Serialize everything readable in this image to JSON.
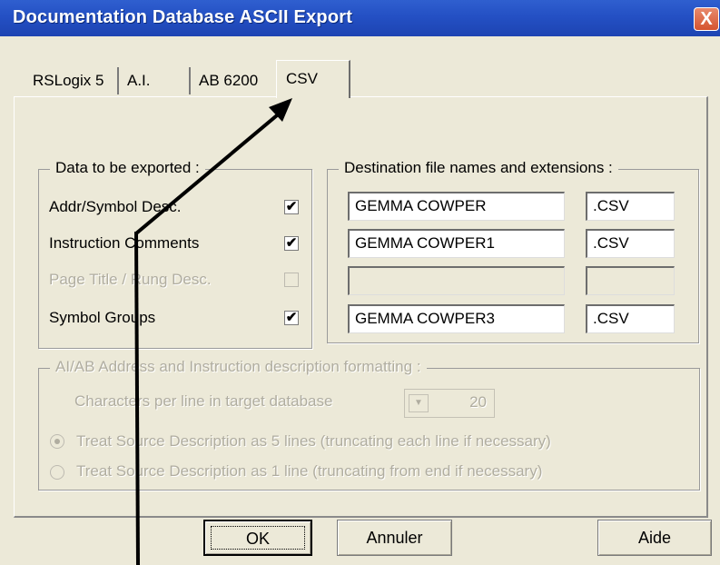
{
  "window": {
    "title": "Documentation Database ASCII Export",
    "close_label": "X"
  },
  "tabs": [
    {
      "label": "RSLogix 5"
    },
    {
      "label": "A.I."
    },
    {
      "label": "AB 6200"
    },
    {
      "label": "CSV",
      "active": true
    }
  ],
  "data_group": {
    "legend": "Data to be exported :",
    "rows": [
      {
        "label": "Addr/Symbol Desc.",
        "checked": true,
        "enabled": true,
        "mark": "✔"
      },
      {
        "label": "Instruction Comments",
        "checked": true,
        "enabled": true,
        "mark": "✔"
      },
      {
        "label": "Page Title / Rung Desc.",
        "checked": false,
        "enabled": false,
        "mark": ""
      },
      {
        "label": "Symbol Groups",
        "checked": true,
        "enabled": true,
        "mark": "✔"
      }
    ]
  },
  "dest_group": {
    "legend": "Destination file names and extensions :",
    "rows": [
      {
        "name": "GEMMA COWPER",
        "ext": ".CSV"
      },
      {
        "name": "GEMMA COWPER1",
        "ext": ".CSV"
      },
      {
        "name": "",
        "ext": ""
      },
      {
        "name": "GEMMA COWPER3",
        "ext": ".CSV"
      }
    ]
  },
  "format_group": {
    "legend": "AI/AB Address and Instruction description formatting :",
    "chars_label": "Characters per line in target database",
    "chars_value": "20",
    "radio1": "Treat Source Description as 5 lines (truncating each line if necessary)",
    "radio2": "Treat Source Description as 1 line (truncating from end if necessary)",
    "radio_selected": 1
  },
  "buttons": {
    "ok": "OK",
    "cancel": "Annuler",
    "help": "Aide"
  },
  "colors": {
    "title_bar": "#2450c4",
    "dialog_bg": "#ece9d8",
    "close_button": "#d5532f"
  }
}
